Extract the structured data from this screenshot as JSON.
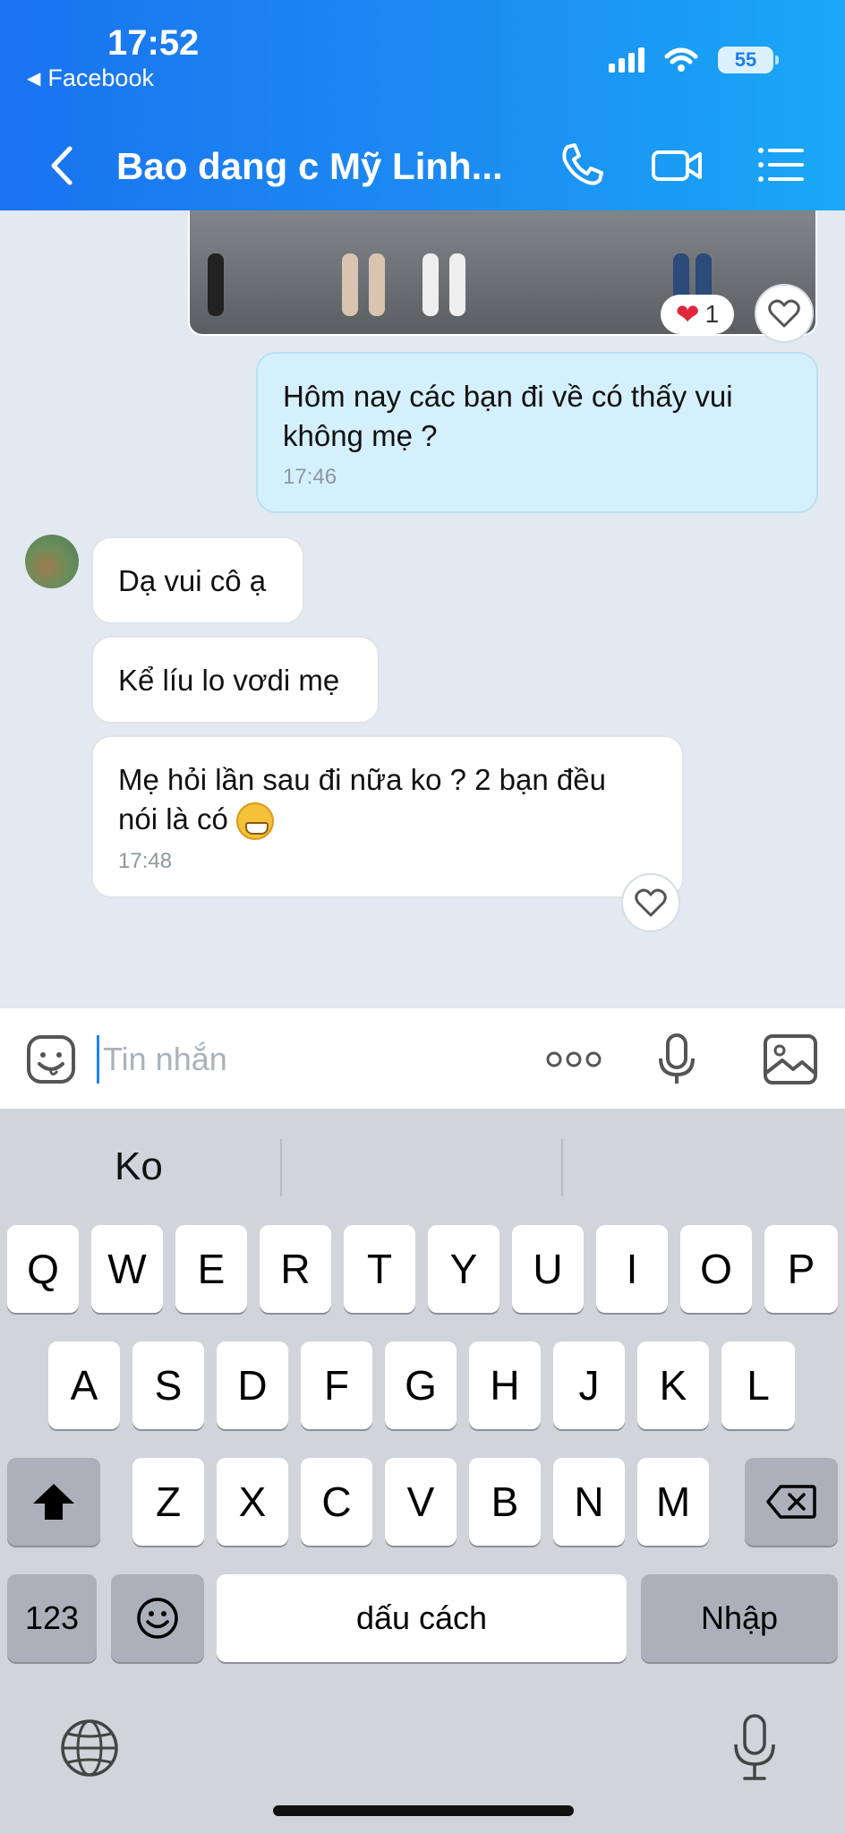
{
  "status": {
    "time": "17:52",
    "back_app": "Facebook",
    "battery": "55"
  },
  "header": {
    "title": "Bao dang c Mỹ Linh..."
  },
  "messages": {
    "sent": {
      "line1": "Hôm nay các bạn đi về có thấy vui",
      "line2": "không mẹ ?",
      "time": "17:46"
    },
    "recv1": {
      "text": "Dạ vui cô ạ"
    },
    "recv2": {
      "text": "Kể líu lo vơdi mẹ"
    },
    "recv3": {
      "line1": "Mẹ hỏi lần sau đi nữa ko ? 2 bạn đều",
      "line2": "nói là có",
      "time": "17:48"
    }
  },
  "reaction": {
    "count": "1"
  },
  "input": {
    "placeholder": "Tin nhắn"
  },
  "keyboard": {
    "suggestions": [
      "Ko",
      "",
      ""
    ],
    "row1": [
      "Q",
      "W",
      "E",
      "R",
      "T",
      "Y",
      "U",
      "I",
      "O",
      "P"
    ],
    "row2": [
      "A",
      "S",
      "D",
      "F",
      "G",
      "H",
      "J",
      "K",
      "L"
    ],
    "row3": [
      "Z",
      "X",
      "C",
      "V",
      "B",
      "N",
      "M"
    ],
    "numbers_key": "123",
    "space_key": "dấu cách",
    "return_key": "Nhập"
  },
  "colors": {
    "header": "#1a86f0",
    "sent_bubble": "#d5f0fd",
    "chat_bg": "#e2e9f0"
  },
  "icons": [
    "back-icon",
    "phone-icon",
    "video-icon",
    "menu-list-icon",
    "sticker-icon",
    "more-icon",
    "mic-icon",
    "image-icon",
    "globe-icon",
    "shift-icon",
    "backspace-icon",
    "emoji-key-icon"
  ]
}
